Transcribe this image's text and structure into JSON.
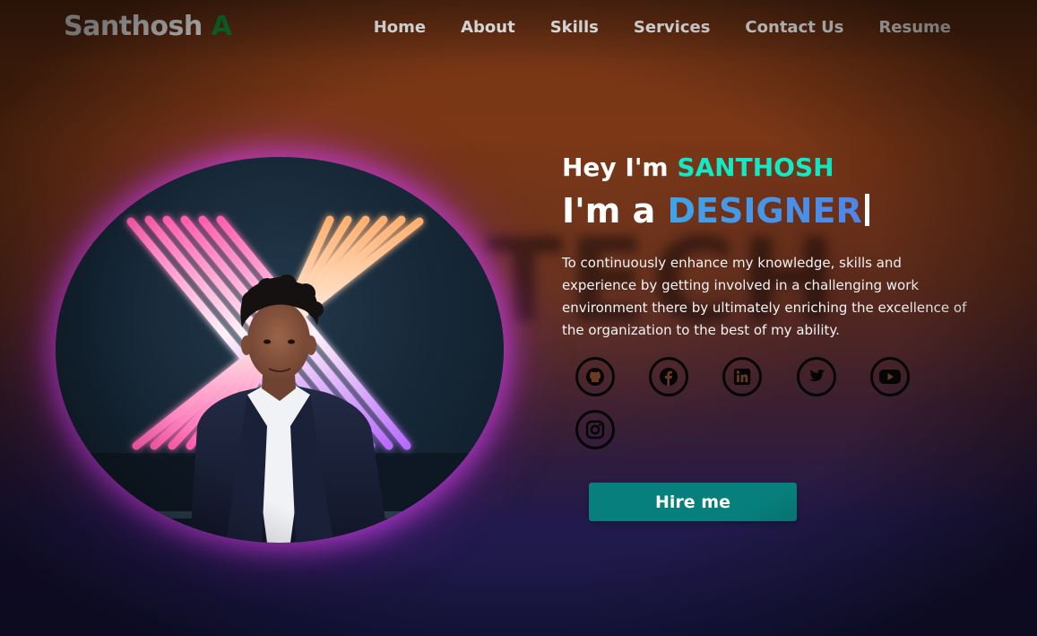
{
  "brand": {
    "name": "Santhosh",
    "initial": "A",
    "accent_color": "#0f8a3a"
  },
  "nav": {
    "items": [
      {
        "label": "Home"
      },
      {
        "label": "About"
      },
      {
        "label": "Skills"
      },
      {
        "label": "Services"
      },
      {
        "label": "Contact Us"
      },
      {
        "label": "Resume"
      }
    ]
  },
  "hero": {
    "greeting_prefix": "Hey I'm",
    "name": "SANTHOSH",
    "role_prefix": "I'm a",
    "role": "DESIGNER",
    "bio": "To continuously enhance my knowledge, skills and experience by getting involved in a challenging work environment there by ultimately enriching the excellence of the organization to the best of my ability.",
    "name_color": "#14e8c4",
    "role_color": "#3fa4e8",
    "photo_icon": "profile-photo"
  },
  "socials": [
    {
      "icon": "github-icon"
    },
    {
      "icon": "facebook-icon"
    },
    {
      "icon": "linkedin-icon"
    },
    {
      "icon": "twitter-icon"
    },
    {
      "icon": "youtube-icon"
    },
    {
      "icon": "instagram-icon"
    }
  ],
  "cta": {
    "label": "Hire me",
    "color": "#077f7d"
  }
}
